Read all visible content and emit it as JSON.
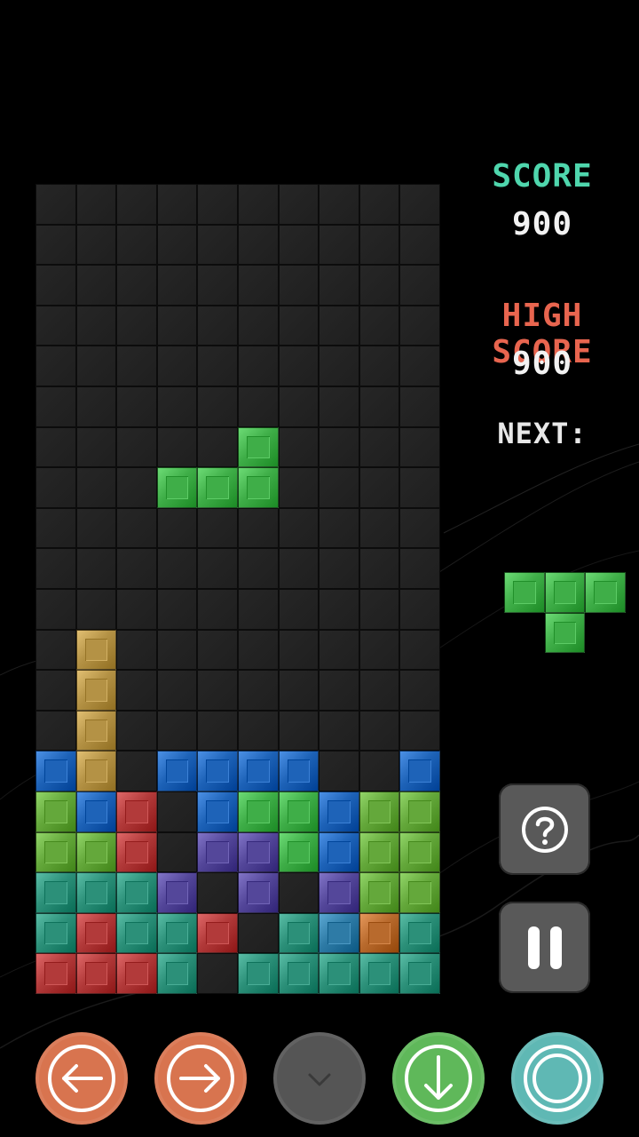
{
  "score": {
    "label": "SCORE",
    "value": "900"
  },
  "high_score": {
    "label": "HIGH SCORE",
    "value": "900"
  },
  "next": {
    "label": "NEXT:",
    "piece": "T"
  },
  "colors": {
    "score_label": "#4fd6ad",
    "high_score_label": "#e8654f",
    "left_button": "#d8744f",
    "right_button": "#d8744f",
    "down_button": "#555555",
    "drop_button": "#5fb85a",
    "rotate_button": "#5fb8b4",
    "help_button": "#5a5a5a",
    "pause_button": "#5a5a5a"
  },
  "board": {
    "columns": 10,
    "rows": 20,
    "palette": {
      "Y": "#b49245",
      "B": "#1e63b8",
      "L": "#64a83b",
      "R": "#b23a3a",
      "P": "#54479a",
      "T": "#2c9079",
      "O": "#b86a2d",
      "G": "#3fae48",
      "S": "#2e7ba6"
    },
    "grid": [
      "..........",
      "..........",
      "..........",
      "..........",
      "..........",
      "..........",
      "..........",
      "..........",
      "..........",
      "..........",
      "..........",
      "..........",
      "..........",
      "..........",
      "..........",
      "..........",
      "..........",
      "..........",
      "..........",
      ".........."
    ],
    "stack": [
      ".Y........",
      ".Y........",
      ".Y........",
      "BY.BBBB..B",
      "LBR.BGGBLL",
      "LLR.PPGBLL",
      "TTTP.P.PLL",
      "TRTTR.TSOT",
      "RRRT.TTTTT"
    ],
    "active_piece": {
      "color": "G",
      "cells": [
        [
          5,
          6
        ],
        [
          3,
          7
        ],
        [
          4,
          7
        ],
        [
          5,
          7
        ]
      ]
    }
  },
  "icons": {
    "help": "question-mark-icon",
    "pause": "pause-icon",
    "left": "arrow-left-icon",
    "right": "arrow-right-icon",
    "down": "chevron-down-icon",
    "drop": "arrow-down-icon",
    "rotate": "rotate-ring-icon"
  }
}
